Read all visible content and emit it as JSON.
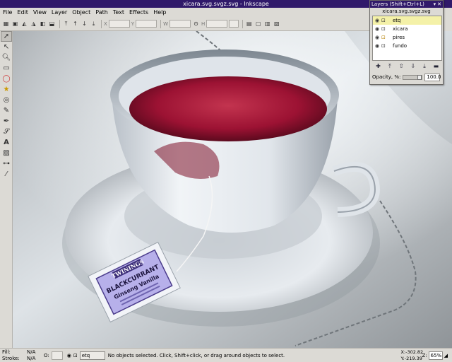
{
  "window": {
    "title": "xicara.svg.svgz.svg - Inkscape"
  },
  "menu": [
    "File",
    "Edit",
    "View",
    "Layer",
    "Object",
    "Path",
    "Text",
    "Effects",
    "Help"
  ],
  "layers_dialog": {
    "title": "Layers (Shift+Ctrl+L)",
    "document": "xicara.svg.svgz.svg",
    "layers": [
      {
        "name": "etq",
        "selected": true
      },
      {
        "name": "xicara",
        "selected": false
      },
      {
        "name": "pires",
        "selected": false
      },
      {
        "name": "fundo",
        "selected": false
      }
    ],
    "opacity_label": "Opacity, %:",
    "opacity_value": "100.0"
  },
  "statusbar": {
    "fill_label": "Fill:",
    "fill_value": "N/A",
    "stroke_label": "Stroke:",
    "stroke_value": "N/A",
    "o_label": "O:",
    "current_layer": "etq",
    "message": "No objects selected. Click, Shift+click, or drag around objects to select.",
    "x_coord": "X:-302.82",
    "y_coord": "Y:-219.39",
    "zoom_label": "Z:",
    "zoom_value": "65%"
  },
  "tea_tag": {
    "brand": "TWININGS",
    "flavor1": "BLACKCURRANT",
    "flavor2": "Ginseng Vanilla"
  },
  "colors": {
    "titlebar": "#30196a",
    "selected_layer": "#f4f1a8",
    "tea": "#9c1233",
    "tag_label": "#b7b0ea"
  }
}
